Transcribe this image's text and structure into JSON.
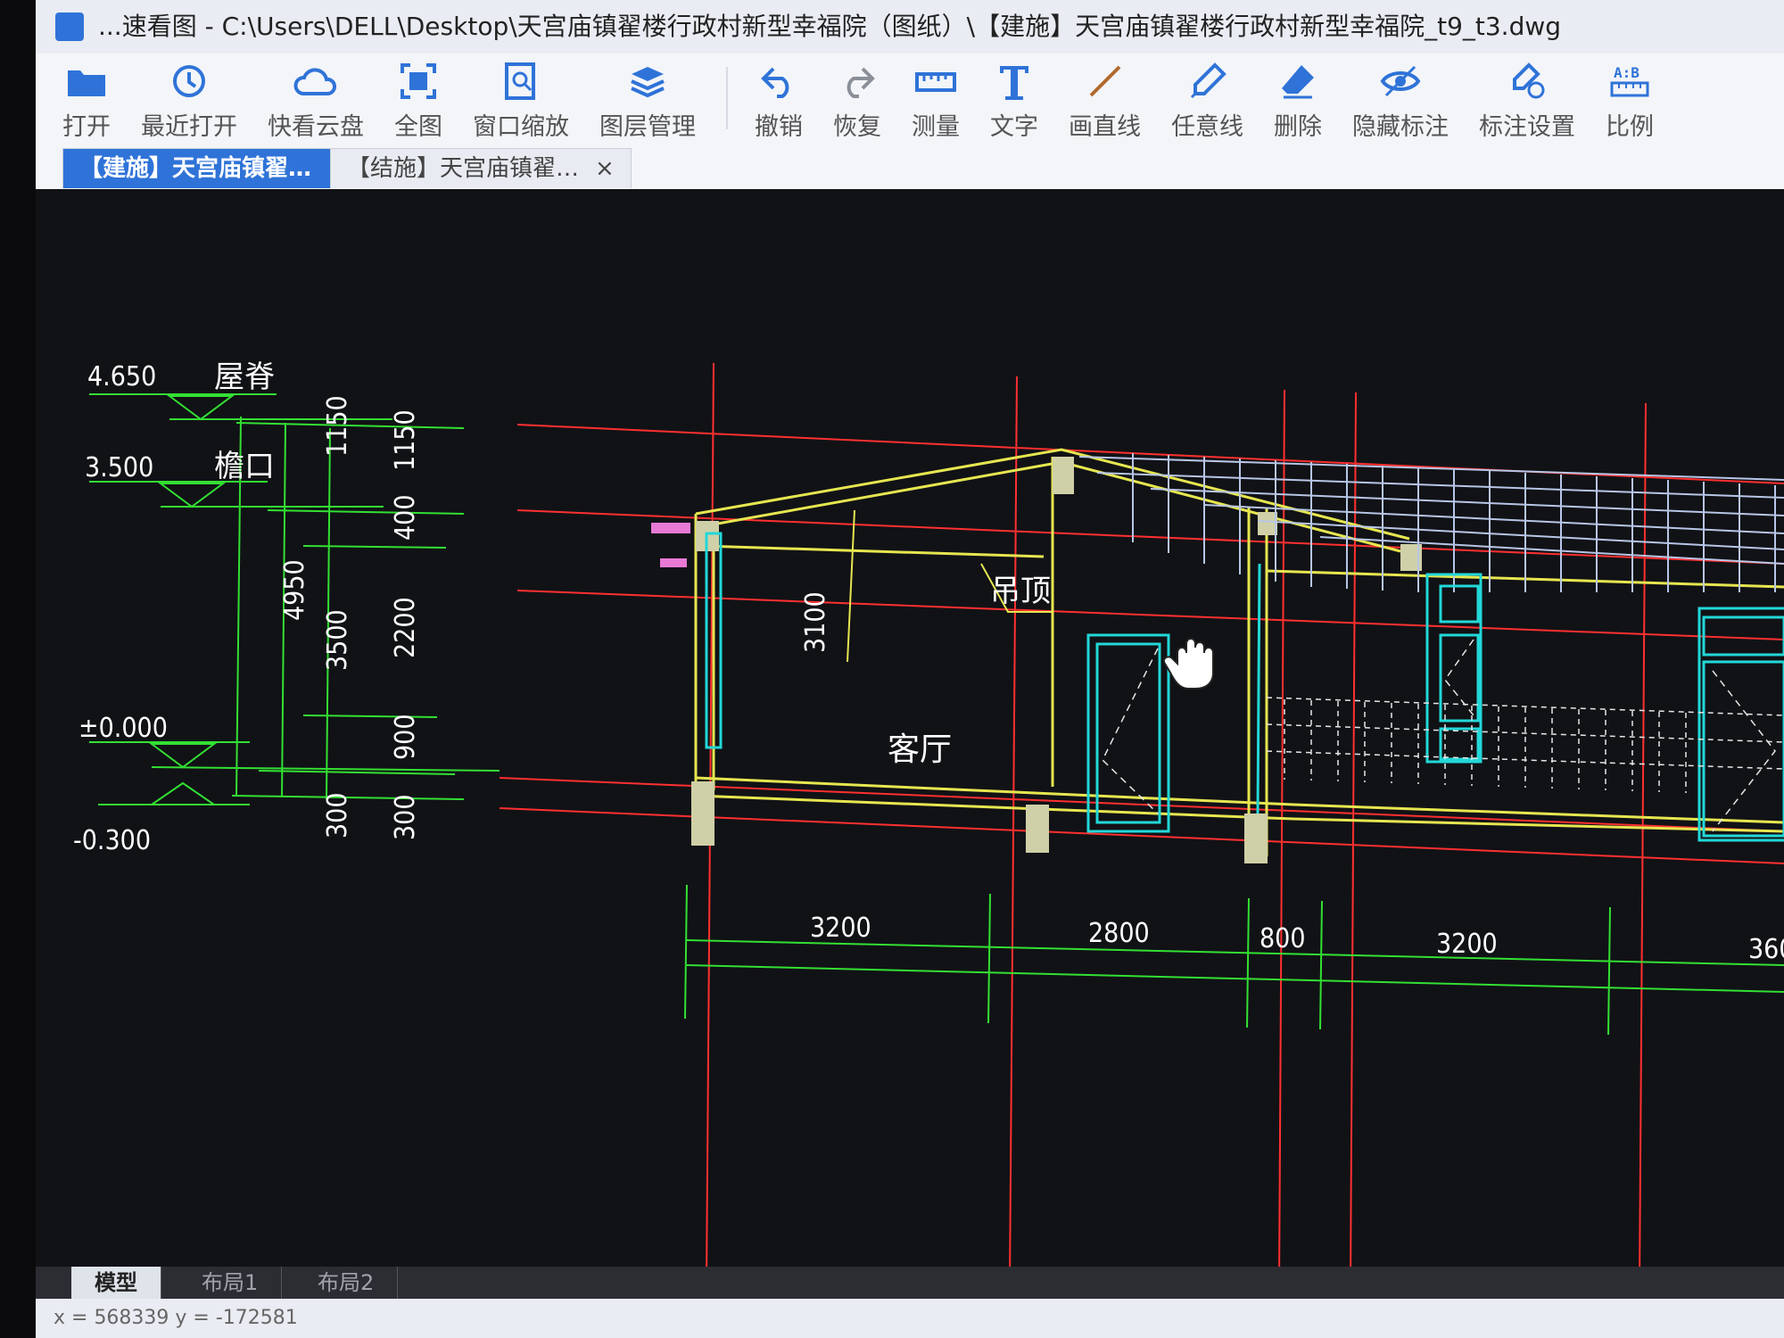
{
  "window": {
    "title": "...速看图 - C:\\Users\\DELL\\Desktop\\天宫庙镇翟楼行政村新型幸福院（图纸）\\【建施】天宫庙镇翟楼行政村新型幸福院_t9_t3.dwg"
  },
  "toolbar": {
    "items": [
      {
        "label": "打开",
        "icon": "folder-icon"
      },
      {
        "label": "最近打开",
        "icon": "history-icon"
      },
      {
        "label": "快看云盘",
        "icon": "cloud-icon"
      },
      {
        "label": "全图",
        "icon": "full-view-icon"
      },
      {
        "label": "窗口缩放",
        "icon": "window-zoom-icon"
      },
      {
        "label": "图层管理",
        "icon": "layers-icon"
      },
      {
        "label": "撤销",
        "icon": "undo-icon"
      },
      {
        "label": "恢复",
        "icon": "redo-icon"
      },
      {
        "label": "测量",
        "icon": "ruler-icon"
      },
      {
        "label": "文字",
        "icon": "text-icon"
      },
      {
        "label": "画直线",
        "icon": "line-icon"
      },
      {
        "label": "任意线",
        "icon": "pen-icon"
      },
      {
        "label": "删除",
        "icon": "eraser-icon"
      },
      {
        "label": "隐藏标注",
        "icon": "eye-hidden-icon"
      },
      {
        "label": "标注设置",
        "icon": "annotation-settings-icon"
      },
      {
        "label": "比例",
        "icon": "scale-icon"
      }
    ]
  },
  "tabs": [
    {
      "label": "【建施】天宫庙镇翟…",
      "close": "×",
      "active": true
    },
    {
      "label": "【结施】天宫庙镇翟…",
      "close": "×",
      "active": false
    }
  ],
  "drawing": {
    "elevations": [
      {
        "value": "4.650",
        "name": "屋脊"
      },
      {
        "value": "3.500",
        "name": "檐口"
      },
      {
        "value": "±0.000",
        "name": ""
      },
      {
        "value": "-0.300",
        "name": ""
      }
    ],
    "vertical_dims": {
      "outer": "4950",
      "middle_top": "1150",
      "middle_main": "3500",
      "middle_bottom": "300",
      "inner_top": "1150",
      "inner_a": "400",
      "inner_b": "2200",
      "inner_c": "900",
      "inner_bottom": "300"
    },
    "room_height": "3100",
    "ceiling_label": "吊顶",
    "room_label": "客厅",
    "horizontal_dims": [
      "3200",
      "2800",
      "800",
      "3200",
      "360"
    ],
    "colors": {
      "background": "#111216",
      "axis": "#ff3030",
      "dimension": "#33e033",
      "outline": "#e6e650",
      "window": "#22d8d8",
      "text": "#ffffff",
      "roof_tile": "#b8c6e6"
    }
  },
  "layout_tabs": [
    {
      "label": "模型",
      "active": true
    },
    {
      "label": "布局1",
      "active": false
    },
    {
      "label": "布局2",
      "active": false
    }
  ],
  "status": {
    "coords": "x = 568339  y = -172581"
  }
}
